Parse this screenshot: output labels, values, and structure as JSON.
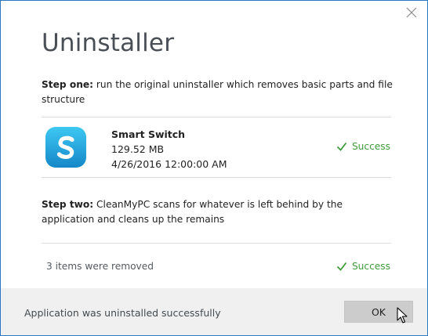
{
  "dialog": {
    "title": "Uninstaller",
    "accent_color": "#2b78c5"
  },
  "step_one": {
    "label": "Step one:",
    "text": " run the original uninstaller which removes basic parts and file structure"
  },
  "app": {
    "name": "Smart Switch",
    "size": "129.52 MB",
    "date": "4/26/2016 12:00:00 AM",
    "icon": "smart-switch-app-icon",
    "status": "Success"
  },
  "step_two": {
    "label": "Step two:",
    "text": " CleanMyPC scans for whatever is left behind by the application and cleans up the remains"
  },
  "cleanup": {
    "removed_text": "3 items were removed",
    "status": "Success",
    "status_color": "#3f9c3a"
  },
  "footer": {
    "message": "Application was uninstalled successfully",
    "ok_label": "OK"
  }
}
